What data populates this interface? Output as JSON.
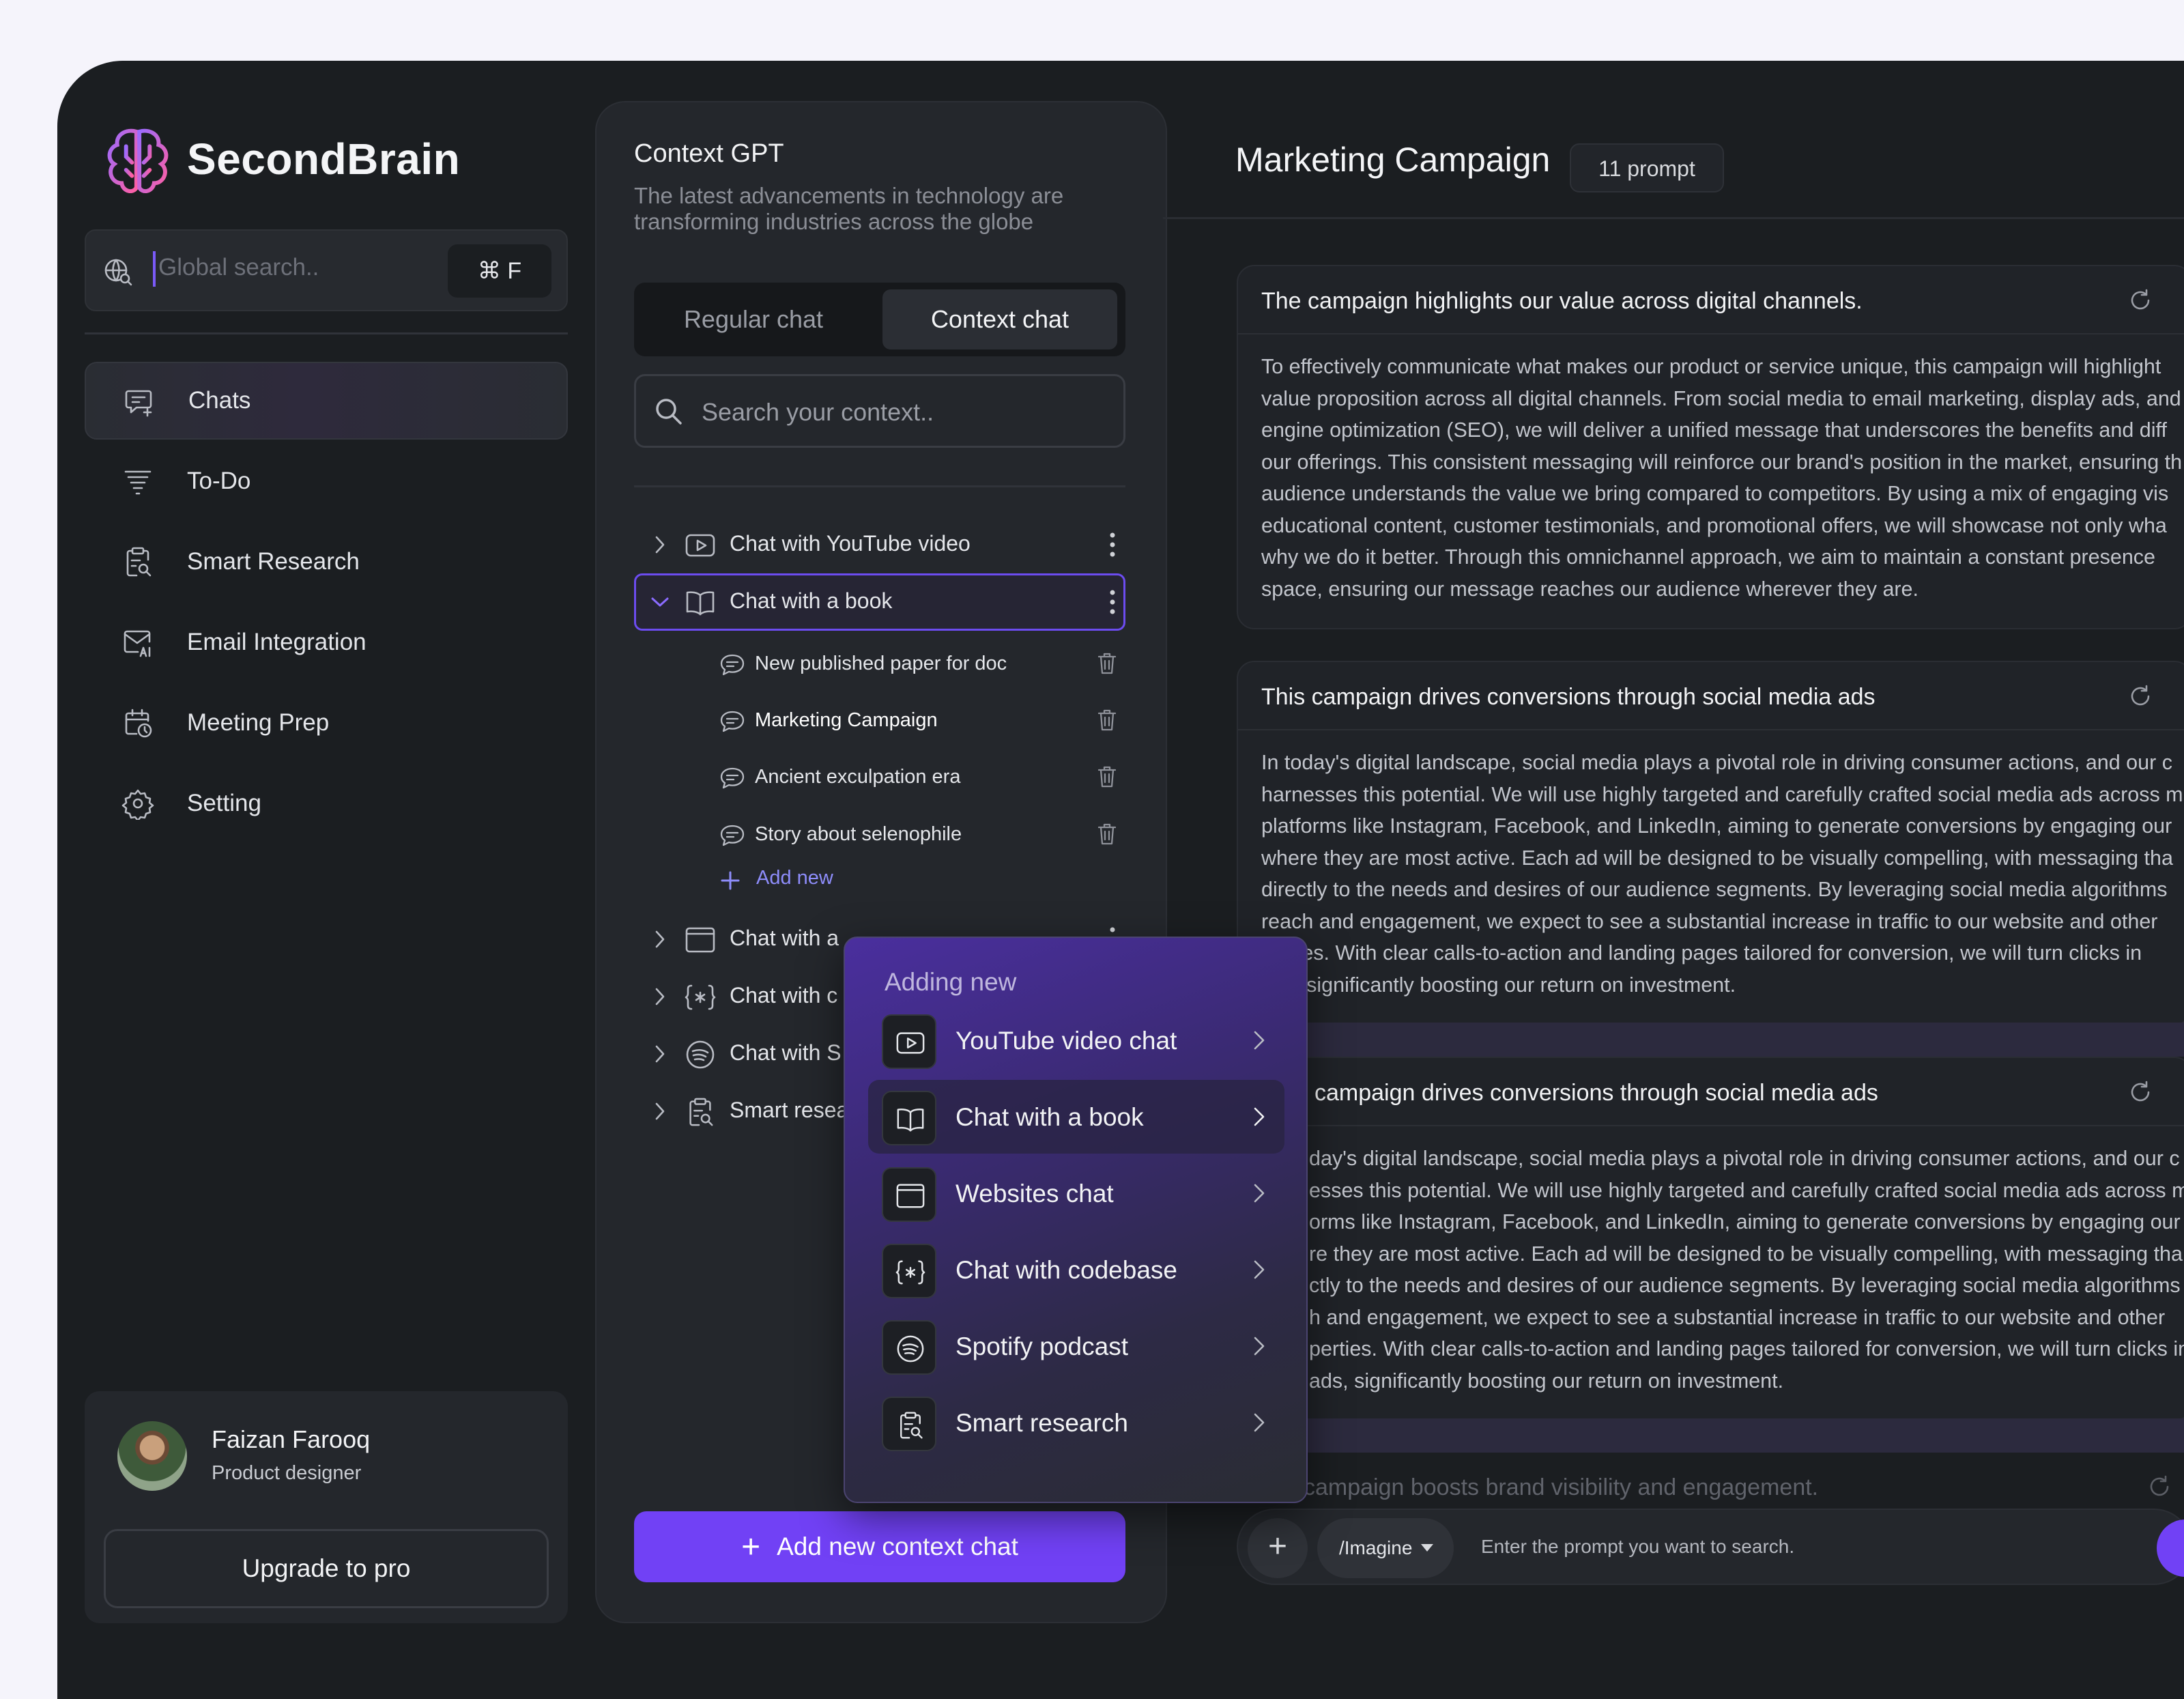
{
  "app": {
    "name": "SecondBrain"
  },
  "search": {
    "placeholder": "Global search..",
    "shortcut": "⌘ F"
  },
  "sidebar": {
    "items": [
      {
        "label": "Chats",
        "icon": "chat-add-icon",
        "active": true
      },
      {
        "label": "To-Do",
        "icon": "filter-list-icon"
      },
      {
        "label": "Smart Research",
        "icon": "clipboard-search-icon"
      },
      {
        "label": "Email Integration",
        "icon": "mail-ai-icon"
      },
      {
        "label": "Meeting Prep",
        "icon": "calendar-clock-icon"
      },
      {
        "label": "Setting",
        "icon": "gear-icon"
      }
    ]
  },
  "profile": {
    "name": "Faizan Farooq",
    "role": "Product designer",
    "upgrade_label": "Upgrade to pro"
  },
  "context": {
    "title": "Context GPT",
    "subtitle": "The latest advancements in technology are transforming industries across the globe",
    "tabs": {
      "regular": "Regular chat",
      "context": "Context chat"
    },
    "search_placeholder": "Search your context..",
    "tree": [
      {
        "label": "Chat with YouTube video",
        "icon": "youtube-icon"
      },
      {
        "label": "Chat with a book",
        "icon": "book-icon",
        "expanded": true
      },
      {
        "label": "Chat with a website",
        "icon": "browser-icon",
        "visible": "Chat with a"
      },
      {
        "label": "Chat with c",
        "icon": "code-icon"
      },
      {
        "label": "Chat with S",
        "icon": "spotify-icon"
      },
      {
        "label": "Smart resea",
        "icon": "clipboard-search-icon"
      }
    ],
    "sub_items": [
      "New published paper for doc",
      "Marketing Campaign",
      "Ancient exculpation era",
      "Story about selenophile"
    ],
    "add_new": "Add new",
    "add_context_label": "Add new context chat"
  },
  "popup": {
    "title": "Adding new",
    "items": [
      "YouTube video chat",
      "Chat with a book",
      "Websites chat",
      "Chat with codebase",
      "Spotify podcast",
      "Smart research"
    ],
    "highlighted_index": 1
  },
  "main": {
    "title": "Marketing Campaign",
    "badge": "11 prompt",
    "cards": [
      {
        "title": "The campaign highlights our value across digital channels.",
        "lines": [
          "To effectively communicate what makes our product or service unique, this campaign will highlight",
          "value proposition across all digital channels. From social media to email marketing, display ads, and",
          "engine optimization (SEO), we will deliver a unified message that underscores the benefits and diff",
          "our offerings. This consistent messaging will reinforce our brand's position in the market, ensuring th",
          "audience understands the value we bring compared to competitors. By using a mix of engaging vis",
          "educational content, customer testimonials, and promotional offers, we will showcase not only wha",
          "why we do it better. Through this omnichannel approach, we aim to maintain a constant presence",
          "space, ensuring our message reaches our audience wherever they are."
        ]
      },
      {
        "title": "This campaign drives conversions through social media ads",
        "lines": [
          "In today's digital landscape, social media plays a pivotal role in driving consumer actions, and our c",
          "harnesses this potential. We will use highly targeted and carefully crafted social media ads across m",
          "platforms like Instagram, Facebook, and LinkedIn, aiming to generate conversions by engaging our",
          "where they are most active. Each ad will be designed to be visually compelling, with messaging tha",
          "directly to the needs and desires of our audience segments. By leveraging social media algorithms",
          "reach and engagement, we expect to see a substantial increase in traffic to our website and other",
          "perties. With clear calls-to-action and landing pages tailored for conversion, we will turn clicks in",
          "ads, significantly boosting our return on investment."
        ]
      },
      {
        "title": "campaign drives conversions through social media ads",
        "lines": [
          "day's digital landscape, social media plays a pivotal role in driving consumer actions, and our c",
          "esses this potential. We will use highly targeted and carefully crafted social media ads across m",
          "orms like Instagram, Facebook, and LinkedIn, aiming to generate conversions by engaging our",
          "re they are most active. Each ad will be designed to be visually compelling, with messaging tha",
          "ctly to the needs and desires of our audience segments. By leveraging social media algorithms",
          "h and engagement, we expect to see a substantial increase in traffic to our website and other",
          "perties. With clear calls-to-action and landing pages tailored for conversion, we will turn clicks in",
          "ads, significantly boosting our return on investment."
        ]
      }
    ],
    "faded_title": "campaign boosts brand visibility and engagement.",
    "input": {
      "mode": "/Imagine",
      "placeholder": "Enter the prompt you want to search."
    }
  }
}
